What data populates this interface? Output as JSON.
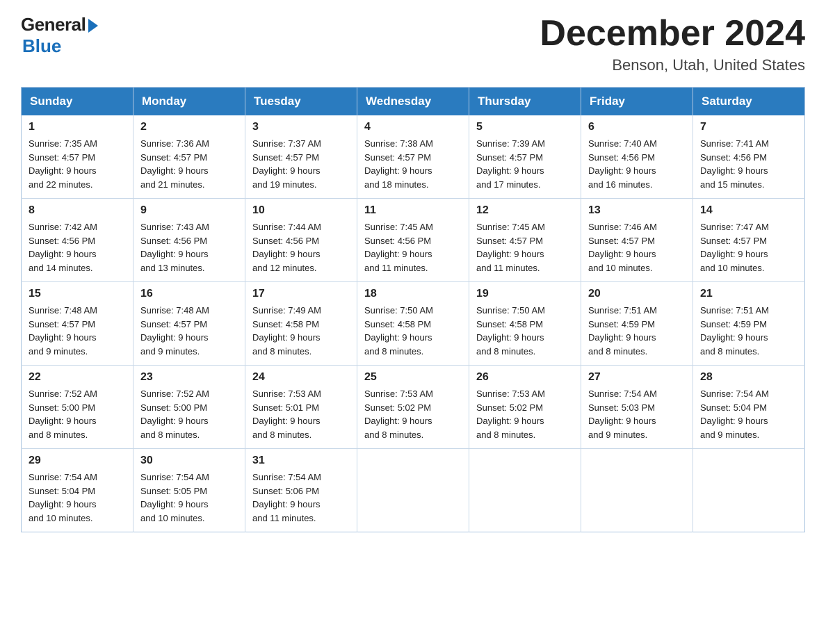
{
  "header": {
    "logo_general": "General",
    "logo_blue": "Blue",
    "month_title": "December 2024",
    "location": "Benson, Utah, United States"
  },
  "days_of_week": [
    "Sunday",
    "Monday",
    "Tuesday",
    "Wednesday",
    "Thursday",
    "Friday",
    "Saturday"
  ],
  "weeks": [
    [
      {
        "day": "1",
        "sunrise": "7:35 AM",
        "sunset": "4:57 PM",
        "daylight": "9 hours and 22 minutes."
      },
      {
        "day": "2",
        "sunrise": "7:36 AM",
        "sunset": "4:57 PM",
        "daylight": "9 hours and 21 minutes."
      },
      {
        "day": "3",
        "sunrise": "7:37 AM",
        "sunset": "4:57 PM",
        "daylight": "9 hours and 19 minutes."
      },
      {
        "day": "4",
        "sunrise": "7:38 AM",
        "sunset": "4:57 PM",
        "daylight": "9 hours and 18 minutes."
      },
      {
        "day": "5",
        "sunrise": "7:39 AM",
        "sunset": "4:57 PM",
        "daylight": "9 hours and 17 minutes."
      },
      {
        "day": "6",
        "sunrise": "7:40 AM",
        "sunset": "4:56 PM",
        "daylight": "9 hours and 16 minutes."
      },
      {
        "day": "7",
        "sunrise": "7:41 AM",
        "sunset": "4:56 PM",
        "daylight": "9 hours and 15 minutes."
      }
    ],
    [
      {
        "day": "8",
        "sunrise": "7:42 AM",
        "sunset": "4:56 PM",
        "daylight": "9 hours and 14 minutes."
      },
      {
        "day": "9",
        "sunrise": "7:43 AM",
        "sunset": "4:56 PM",
        "daylight": "9 hours and 13 minutes."
      },
      {
        "day": "10",
        "sunrise": "7:44 AM",
        "sunset": "4:56 PM",
        "daylight": "9 hours and 12 minutes."
      },
      {
        "day": "11",
        "sunrise": "7:45 AM",
        "sunset": "4:56 PM",
        "daylight": "9 hours and 11 minutes."
      },
      {
        "day": "12",
        "sunrise": "7:45 AM",
        "sunset": "4:57 PM",
        "daylight": "9 hours and 11 minutes."
      },
      {
        "day": "13",
        "sunrise": "7:46 AM",
        "sunset": "4:57 PM",
        "daylight": "9 hours and 10 minutes."
      },
      {
        "day": "14",
        "sunrise": "7:47 AM",
        "sunset": "4:57 PM",
        "daylight": "9 hours and 10 minutes."
      }
    ],
    [
      {
        "day": "15",
        "sunrise": "7:48 AM",
        "sunset": "4:57 PM",
        "daylight": "9 hours and 9 minutes."
      },
      {
        "day": "16",
        "sunrise": "7:48 AM",
        "sunset": "4:57 PM",
        "daylight": "9 hours and 9 minutes."
      },
      {
        "day": "17",
        "sunrise": "7:49 AM",
        "sunset": "4:58 PM",
        "daylight": "9 hours and 8 minutes."
      },
      {
        "day": "18",
        "sunrise": "7:50 AM",
        "sunset": "4:58 PM",
        "daylight": "9 hours and 8 minutes."
      },
      {
        "day": "19",
        "sunrise": "7:50 AM",
        "sunset": "4:58 PM",
        "daylight": "9 hours and 8 minutes."
      },
      {
        "day": "20",
        "sunrise": "7:51 AM",
        "sunset": "4:59 PM",
        "daylight": "9 hours and 8 minutes."
      },
      {
        "day": "21",
        "sunrise": "7:51 AM",
        "sunset": "4:59 PM",
        "daylight": "9 hours and 8 minutes."
      }
    ],
    [
      {
        "day": "22",
        "sunrise": "7:52 AM",
        "sunset": "5:00 PM",
        "daylight": "9 hours and 8 minutes."
      },
      {
        "day": "23",
        "sunrise": "7:52 AM",
        "sunset": "5:00 PM",
        "daylight": "9 hours and 8 minutes."
      },
      {
        "day": "24",
        "sunrise": "7:53 AM",
        "sunset": "5:01 PM",
        "daylight": "9 hours and 8 minutes."
      },
      {
        "day": "25",
        "sunrise": "7:53 AM",
        "sunset": "5:02 PM",
        "daylight": "9 hours and 8 minutes."
      },
      {
        "day": "26",
        "sunrise": "7:53 AM",
        "sunset": "5:02 PM",
        "daylight": "9 hours and 8 minutes."
      },
      {
        "day": "27",
        "sunrise": "7:54 AM",
        "sunset": "5:03 PM",
        "daylight": "9 hours and 9 minutes."
      },
      {
        "day": "28",
        "sunrise": "7:54 AM",
        "sunset": "5:04 PM",
        "daylight": "9 hours and 9 minutes."
      }
    ],
    [
      {
        "day": "29",
        "sunrise": "7:54 AM",
        "sunset": "5:04 PM",
        "daylight": "9 hours and 10 minutes."
      },
      {
        "day": "30",
        "sunrise": "7:54 AM",
        "sunset": "5:05 PM",
        "daylight": "9 hours and 10 minutes."
      },
      {
        "day": "31",
        "sunrise": "7:54 AM",
        "sunset": "5:06 PM",
        "daylight": "9 hours and 11 minutes."
      },
      null,
      null,
      null,
      null
    ]
  ],
  "labels": {
    "sunrise": "Sunrise: ",
    "sunset": "Sunset: ",
    "daylight": "Daylight: "
  }
}
